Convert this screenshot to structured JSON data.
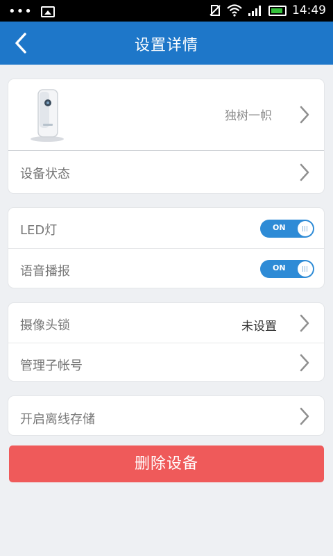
{
  "status_bar": {
    "time": "14:49"
  },
  "header": {
    "title": "设置详情"
  },
  "device_card": {
    "device_name": "独树一帜",
    "status_label": "设备状态"
  },
  "toggles_card": {
    "led_label": "LED灯",
    "led_state": "ON",
    "voice_label": "语音播报",
    "voice_state": "ON"
  },
  "security_card": {
    "lock_label": "摄像头锁",
    "lock_value": "未设置",
    "sub_account_label": "管理子帐号"
  },
  "storage_card": {
    "offline_storage_label": "开启离线存储"
  },
  "delete_button": {
    "label": "删除设备"
  }
}
